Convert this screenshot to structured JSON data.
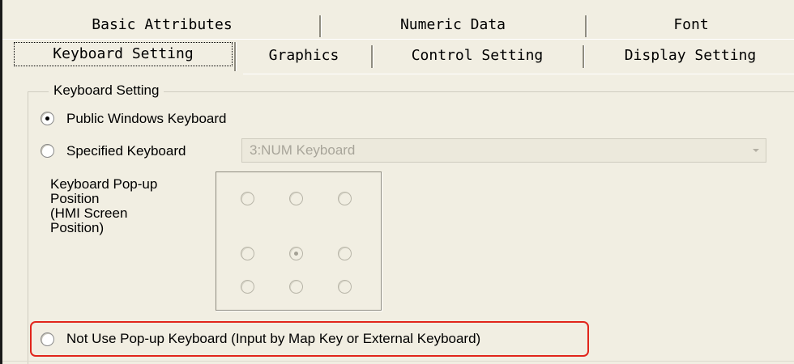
{
  "tabs": {
    "row1": [
      "Basic Attributes",
      "Numeric Data",
      "Font"
    ],
    "row2": [
      "Keyboard Setting",
      "Graphics",
      "Control Setting",
      "Display Setting"
    ],
    "active": "Keyboard Setting"
  },
  "keyboard_group": {
    "legend": "Keyboard Setting",
    "public_windows_keyboard": {
      "label": "Public Windows Keyboard",
      "checked": true
    },
    "specified_keyboard": {
      "label": "Specified Keyboard",
      "checked": false
    },
    "keyboard_combo": {
      "value": "3:NUM Keyboard",
      "disabled": true
    },
    "popup_position": {
      "label_lines": [
        "Keyboard Pop-up",
        "Position",
        "(HMI Screen",
        "Position)"
      ],
      "selected": "middle-center",
      "disabled": true
    },
    "not_use_popup": {
      "label": "Not Use Pop-up Keyboard (Input by Map Key or External Keyboard)",
      "checked": false
    }
  },
  "colors": {
    "panel_bg": "#f1eee2",
    "highlight_border": "#e1251b",
    "disabled_text": "#a8a59a"
  }
}
